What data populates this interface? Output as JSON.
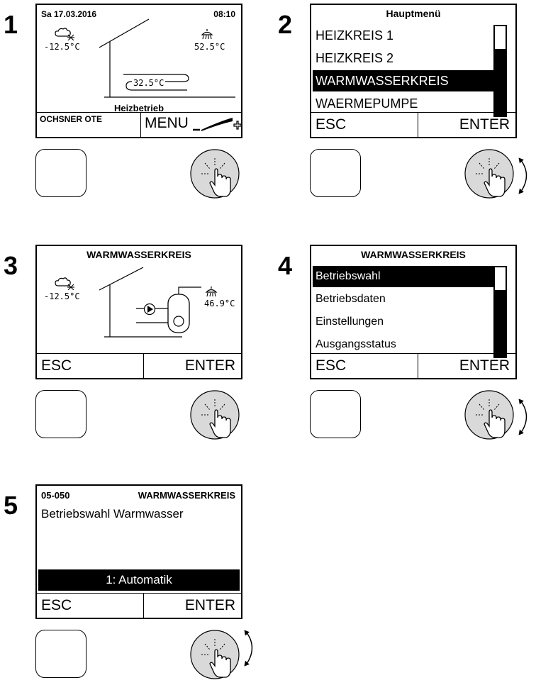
{
  "steps": [
    {
      "number": "1",
      "date": "Sa 17.03.2016",
      "time": "08:10",
      "outside_temp": "-12.5°C",
      "water_temp": "52.5°C",
      "floor_temp": "32.5°C",
      "mode": "Heizbetrieb",
      "brand": "OCHSNER OTE",
      "menu_label": "MENU"
    },
    {
      "number": "2",
      "title": "Hauptmenü",
      "items": [
        "HEIZKREIS 1",
        "HEIZKREIS 2",
        "WARMWASSERKREIS",
        "WAERMEPUMPE"
      ],
      "selected_index": 2,
      "esc": "ESC",
      "enter": "ENTER"
    },
    {
      "number": "3",
      "title": "WARMWASSERKREIS",
      "outside_temp": "-12.5°C",
      "water_temp": "46.9°C",
      "esc": "ESC",
      "enter": "ENTER"
    },
    {
      "number": "4",
      "title": "WARMWASSERKREIS",
      "items": [
        "Betriebswahl",
        "Betriebsdaten",
        "Einstellungen",
        "Ausgangsstatus"
      ],
      "selected_index": 0,
      "esc": "ESC",
      "enter": "ENTER"
    },
    {
      "number": "5",
      "code": "05-050",
      "title": "WARMWASSERKREIS",
      "subtitle": "Betriebswahl Warmwasser",
      "value": "1: Automatik",
      "esc": "ESC",
      "enter": "ENTER"
    }
  ],
  "colors": {
    "selection_bg": "#000000",
    "knob_fill": "#d9d9d9"
  },
  "icons": [
    "cloud-snow-icon",
    "shower-icon",
    "heating-coil-icon",
    "pump-icon",
    "boiler-icon",
    "hand-press-icon",
    "rotate-arrow-icon"
  ]
}
